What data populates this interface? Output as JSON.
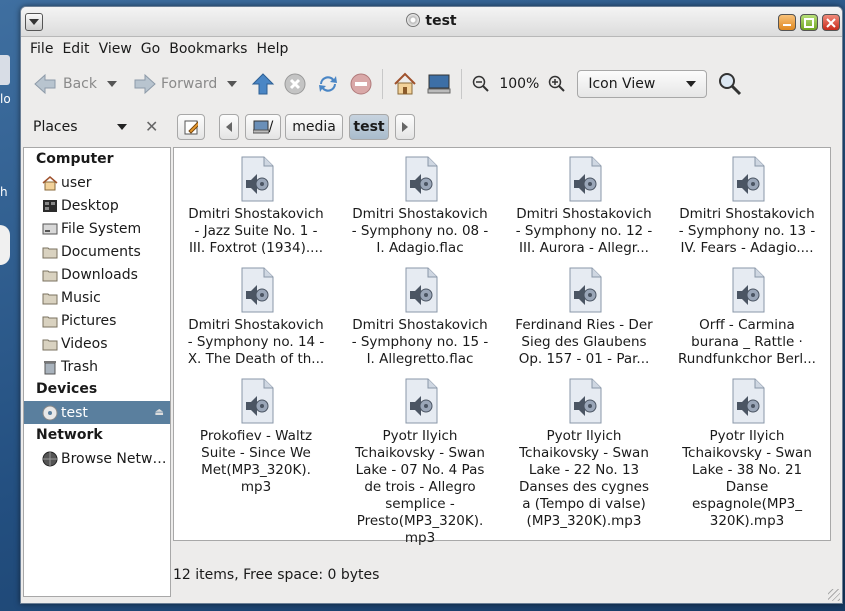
{
  "desktop": {
    "left_text_1": "lo",
    "left_text_2": "h"
  },
  "window": {
    "title": "test"
  },
  "menubar": [
    "File",
    "Edit",
    "View",
    "Go",
    "Bookmarks",
    "Help"
  ],
  "toolbar": {
    "back": "Back",
    "forward": "Forward",
    "zoom": "100%",
    "view_mode": "Icon View"
  },
  "location": {
    "places_label": "Places",
    "path": [
      "/",
      "media",
      "test"
    ]
  },
  "sidebar": {
    "sections": [
      {
        "title": "Computer",
        "items": [
          {
            "label": "user",
            "icon": "home-icon"
          },
          {
            "label": "Desktop",
            "icon": "desktop-icon"
          },
          {
            "label": "File System",
            "icon": "drive-icon"
          },
          {
            "label": "Documents",
            "icon": "folder-icon"
          },
          {
            "label": "Downloads",
            "icon": "folder-icon"
          },
          {
            "label": "Music",
            "icon": "folder-icon"
          },
          {
            "label": "Pictures",
            "icon": "folder-icon"
          },
          {
            "label": "Videos",
            "icon": "folder-icon"
          },
          {
            "label": "Trash",
            "icon": "trash-icon"
          }
        ]
      },
      {
        "title": "Devices",
        "items": [
          {
            "label": "test",
            "icon": "cd-icon",
            "selected": true
          }
        ]
      },
      {
        "title": "Network",
        "items": [
          {
            "label": "Browse Netw…",
            "icon": "network-icon"
          }
        ]
      }
    ]
  },
  "files": [
    {
      "lines": [
        "Dmitri Shostakovich",
        "- Jazz Suite No. 1 -",
        "III. Foxtrot (1934)...."
      ]
    },
    {
      "lines": [
        "Dmitri Shostakovich",
        "- Symphony no. 08 -",
        "I. Adagio.flac"
      ]
    },
    {
      "lines": [
        "Dmitri Shostakovich",
        "- Symphony no. 12 -",
        "III. Aurora - Allegr..."
      ]
    },
    {
      "lines": [
        "Dmitri Shostakovich",
        "- Symphony no. 13 -",
        "IV. Fears - Adagio...."
      ]
    },
    {
      "lines": [
        "Dmitri Shostakovich",
        "- Symphony no. 14 -",
        "X. The Death of th..."
      ]
    },
    {
      "lines": [
        "Dmitri Shostakovich",
        "- Symphony no. 15 -",
        "I. Allegretto.flac"
      ]
    },
    {
      "lines": [
        "Ferdinand Ries - Der",
        "Sieg des Glaubens",
        "Op. 157 - 01 - Par..."
      ]
    },
    {
      "lines": [
        "Orff - Carmina",
        "burana _ Rattle ·",
        "Rundfunkchor Berl..."
      ]
    },
    {
      "lines": [
        "Prokofiev - Waltz",
        "Suite - Since We",
        "Met(MP3_320K).",
        "mp3"
      ]
    },
    {
      "lines": [
        "Pyotr Ilyich",
        "Tchaikovsky - Swan",
        "Lake - 07 No. 4 Pas",
        "de trois - Allegro",
        "semplice -",
        "Presto(MP3_320K).",
        "mp3"
      ]
    },
    {
      "lines": [
        "Pyotr Ilyich",
        "Tchaikovsky - Swan",
        "Lake - 22 No. 13",
        "Danses des cygnes",
        "a (Tempo di valse)",
        "(MP3_320K).mp3"
      ]
    },
    {
      "lines": [
        "Pyotr Ilyich",
        "Tchaikovsky - Swan",
        "Lake - 38 No.  21",
        "Danse",
        "espagnole(MP3_",
        "320K).mp3"
      ]
    }
  ],
  "status": "12 items, Free space: 0 bytes",
  "colors": {
    "selection": "#5a7f9e",
    "desktop": "#234f80"
  }
}
